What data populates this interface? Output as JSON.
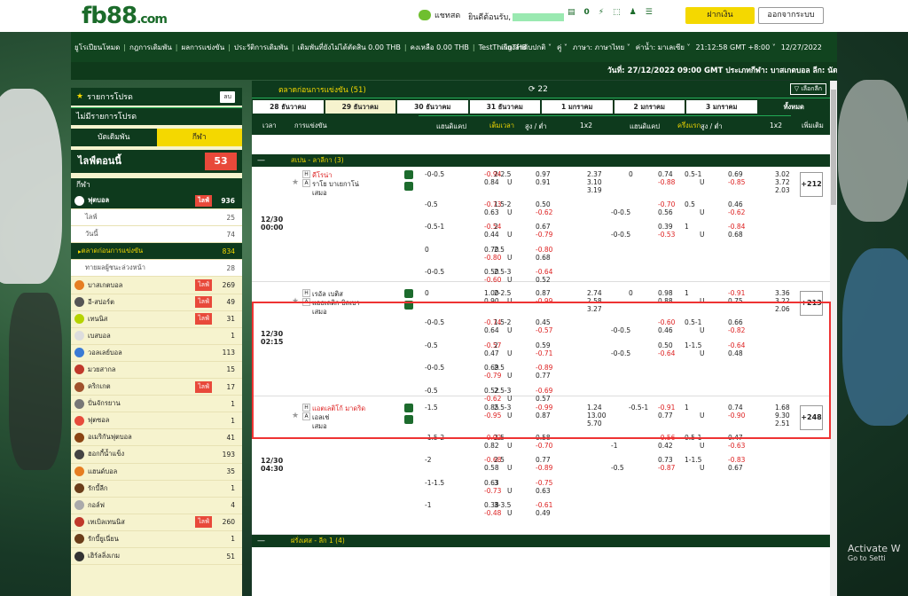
{
  "header": {
    "logo": "fb88",
    "logo_suffix": ".com",
    "chat": "แชทสด",
    "welcome": "ยินดีต้อนรับ,",
    "balance": "0",
    "deposit": "ฝากเงิน",
    "logout": "ออกจากระบบ"
  },
  "nav": {
    "items": [
      "ยูโรเปียนโหมด",
      "กฎการเดิมพัน",
      "ผลการแข่งขัน",
      "ประวัติการเดิมพัน",
      "เดิมพันที่ยังไม่ได้ตัดสิน 0.00 THB",
      "คงเหลือ 0.00 THB",
      "TestThingTHB"
    ],
    "right": [
      "เรียงลำดับปกติ ˅",
      "คู่ ˅",
      "ภาษา: ภาษาไทย ˅",
      "ค่าน้ำ: มาเลเซีย ˅",
      "21:12:58 GMT +8:00 ˅",
      "12/27/2022"
    ]
  },
  "ticker": "วันที่: 27/12/2022 09:00 GMT ประเภทกีฬา: บาสเกตบอล ลีก: นัดกระชับ",
  "left": {
    "title": "รายการโปรด",
    "read_only": "ลบ",
    "fav": "ไม่มีรายการโปรด",
    "tab_a": "บัตเดิมพัน",
    "tab_b": "กีฬา",
    "live_label": "ไลฟ์ตอนนี้",
    "live_count": "53",
    "sports_header": "กีฬา",
    "rows": [
      {
        "label": "ฟุตบอล",
        "live": "ไลฟ์",
        "count": "936",
        "kind": "sel",
        "icon": "soccer-ball-icon",
        "color": "#fff"
      },
      {
        "label": "ไลฟ์",
        "live": "",
        "count": "25",
        "kind": "sub",
        "icon": "",
        "color": ""
      },
      {
        "label": "วันนี้",
        "live": "",
        "count": "74",
        "kind": "sub",
        "icon": "",
        "color": ""
      },
      {
        "label": "ตลาดก่อนการแข่งขัน",
        "live": "",
        "count": "834",
        "kind": "act",
        "icon": "",
        "color": ""
      },
      {
        "label": "ทายผลผู้ชนะล่วงหน้า",
        "live": "",
        "count": "28",
        "kind": "sub",
        "icon": "",
        "color": ""
      },
      {
        "label": "บาสเกตบอล",
        "live": "ไลฟ์",
        "count": "269",
        "kind": "n",
        "icon": "basketball-icon",
        "color": "#e67e22"
      },
      {
        "label": "อี-สปอร์ต",
        "live": "ไลฟ์",
        "count": "49",
        "kind": "n",
        "icon": "gamepad-icon",
        "color": "#555"
      },
      {
        "label": "เทนนิส",
        "live": "ไลฟ์",
        "count": "31",
        "kind": "n",
        "icon": "tennis-ball-icon",
        "color": "#b5d300"
      },
      {
        "label": "เบสบอล",
        "live": "",
        "count": "1",
        "kind": "n",
        "icon": "baseball-icon",
        "color": "#ddd"
      },
      {
        "label": "วอลเลย์บอล",
        "live": "",
        "count": "113",
        "kind": "n",
        "icon": "volleyball-icon",
        "color": "#3a7bd5"
      },
      {
        "label": "มวยสากล",
        "live": "",
        "count": "15",
        "kind": "n",
        "icon": "boxing-glove-icon",
        "color": "#c0392b"
      },
      {
        "label": "คริกเกต",
        "live": "ไลฟ์",
        "count": "17",
        "kind": "n",
        "icon": "cricket-icon",
        "color": "#a0522d"
      },
      {
        "label": "ปั่นจักรยาน",
        "live": "",
        "count": "1",
        "kind": "n",
        "icon": "cycling-icon",
        "color": "#777"
      },
      {
        "label": "ฟุตซอล",
        "live": "",
        "count": "1",
        "kind": "n",
        "icon": "futsal-icon",
        "color": "#e74c3c"
      },
      {
        "label": "อเมริกันฟุตบอล",
        "live": "",
        "count": "41",
        "kind": "n",
        "icon": "american-football-icon",
        "color": "#8b4513"
      },
      {
        "label": "ฮอกกี้น้ำแข็ง",
        "live": "",
        "count": "193",
        "kind": "n",
        "icon": "hockey-icon",
        "color": "#444"
      },
      {
        "label": "แฮนด์บอล",
        "live": "",
        "count": "35",
        "kind": "n",
        "icon": "handball-icon",
        "color": "#e67e22"
      },
      {
        "label": "รักบี้ลีก",
        "live": "",
        "count": "1",
        "kind": "n",
        "icon": "rugby-icon",
        "color": "#6b3e1a"
      },
      {
        "label": "กอล์ฟ",
        "live": "",
        "count": "4",
        "kind": "n",
        "icon": "golf-icon",
        "color": "#aaa"
      },
      {
        "label": "เทเบิลเทนนิส",
        "live": "ไลฟ์",
        "count": "260",
        "kind": "n",
        "icon": "table-tennis-icon",
        "color": "#c0392b"
      },
      {
        "label": "รักบี้ยูเนี่ยน",
        "live": "",
        "count": "1",
        "kind": "n",
        "icon": "rugby-union-icon",
        "color": "#6b3e1a"
      },
      {
        "label": "เฮิร์ลลิ่งเกม",
        "live": "",
        "count": "51",
        "kind": "n",
        "icon": "darts-icon",
        "color": "#333"
      }
    ]
  },
  "main": {
    "title": "ตลาดก่อนการแข่งขัน (51)",
    "refresh": "22",
    "pick": "เลือกลีก",
    "dates": [
      "28 ธันวาคม",
      "29 ธันวาคม",
      "30 ธันวาคม",
      "31 ธันวาคม",
      "1 มกราคม",
      "2 มกราคม",
      "3 มกราคม",
      "ทั้งหมด"
    ],
    "cols": {
      "time": "เวลา",
      "event": "การแข่งขัน",
      "full": "เต็มเวลา",
      "half": "ครึ่งแรก",
      "hdp": "แฮนดิแคป",
      "ou": "สูง / ต่ำ",
      "x12": "1x2",
      "more": "เพิ่มเติม"
    },
    "league1": "สเปน - ลาลีกา (3)",
    "league2": "ฝรั่งเศส - ลีก 1 (4)",
    "matches": [
      {
        "date": "12/30",
        "time": "00:00",
        "home": "คีโรน่า",
        "away": "ราโย บาเยกาโน่",
        "draw": "เสมอ",
        "more": "+212",
        "x12": [
          "2.37",
          "3.10",
          "3.19"
        ],
        "hx12": [
          "3.02",
          "3.72",
          "2.03"
        ],
        "lines": [
          [
            "-0-0.5",
            "-0.94",
            "0.84",
            "2-2.5",
            "U",
            "0.97",
            "0.91",
            "0",
            "0.74",
            "-0.88",
            "0.5-1",
            "U",
            "0.69",
            "-0.85"
          ],
          [
            "-0.5",
            "-0.73",
            "0.63",
            "1.5-2",
            "U",
            "0.50",
            "-0.62",
            "-0-0.5",
            "-0.70",
            "0.56",
            "0.5",
            "U",
            "0.46",
            "-0.62"
          ],
          [
            "-0.5-1",
            "-0.54",
            "0.44",
            "2",
            "U",
            "0.67",
            "-0.79",
            "-0-0.5",
            "0.39",
            "-0.53",
            "1",
            "U",
            "-0.84",
            "0.68"
          ],
          [
            "0",
            "0.70",
            "-0.80",
            "2.5",
            "U",
            "-0.80",
            "0.68",
            "",
            "",
            "",
            "",
            "",
            "",
            ""
          ],
          [
            "-0-0.5",
            "0.50",
            "-0.60",
            "2.5-3",
            "U",
            "-0.64",
            "0.52",
            "",
            "",
            "",
            "",
            "",
            "",
            ""
          ]
        ]
      },
      {
        "date": "12/30",
        "time": "02:15",
        "home": "เรอัล เบติส",
        "away": "แอธเลติก บิลเบา",
        "draw": "เสมอ",
        "more": "+213",
        "x12": [
          "2.74",
          "2.58",
          "3.27"
        ],
        "hx12": [
          "3.36",
          "3.22",
          "2.06"
        ],
        "lines": [
          [
            "0",
            "1.00",
            "0.90",
            "2-2.5",
            "U",
            "0.87",
            "-0.99",
            "0",
            "0.98",
            "0.88",
            "1",
            "U",
            "-0.91",
            "0.75"
          ],
          [
            "-0-0.5",
            "-0.74",
            "0.64",
            "1.5-2",
            "U",
            "0.45",
            "-0.57",
            "-0-0.5",
            "-0.60",
            "0.46",
            "0.5-1",
            "U",
            "0.66",
            "-0.82"
          ],
          [
            "-0.5",
            "-0.57",
            "0.47",
            "2",
            "U",
            "0.59",
            "-0.71",
            "-0-0.5",
            "0.50",
            "-0.64",
            "1-1.5",
            "U",
            "-0.64",
            "0.48"
          ],
          [
            "-0-0.5",
            "0.69",
            "-0.79",
            "2.5",
            "U",
            "-0.89",
            "0.77",
            "",
            "",
            "",
            "",
            "",
            "",
            ""
          ],
          [
            "-0.5",
            "0.52",
            "-0.62",
            "2.5-3",
            "U",
            "-0.69",
            "0.57",
            "",
            "",
            "",
            "",
            "",
            "",
            ""
          ]
        ]
      },
      {
        "date": "12/30",
        "time": "04:30",
        "home": "แอตเลติโก้ มาดริด",
        "away": "เอลเช่",
        "draw": "เสมอ",
        "more": "+248",
        "x12": [
          "1.24",
          "13.00",
          "5.70"
        ],
        "hx12": [
          "1.68",
          "9.30",
          "2.51"
        ],
        "lines": [
          [
            "-1.5",
            "0.85",
            "-0.95",
            "2.5-3",
            "U",
            "-0.99",
            "0.87",
            "-0.5-1",
            "-0.91",
            "0.77",
            "1",
            "U",
            "0.74",
            "-0.90"
          ],
          [
            "-1.5-2",
            "-0.92",
            "0.82",
            "2.5",
            "U",
            "0.58",
            "-0.70",
            "-1",
            "-0.56",
            "0.42",
            "0.5-1",
            "U",
            "0.47",
            "-0.63"
          ],
          [
            "-2",
            "-0.68",
            "0.58",
            "2.5",
            "U",
            "0.77",
            "-0.89",
            "-0.5",
            "0.73",
            "-0.87",
            "1-1.5",
            "U",
            "-0.83",
            "0.67"
          ],
          [
            "-1-1.5",
            "0.63",
            "-0.73",
            "3",
            "U",
            "-0.75",
            "0.63",
            "",
            "",
            "",
            "",
            "",
            "",
            ""
          ],
          [
            "-1",
            "0.38",
            "-0.48",
            "3-3.5",
            "U",
            "-0.61",
            "0.49",
            "",
            "",
            "",
            "",
            "",
            "",
            ""
          ]
        ]
      }
    ]
  },
  "os": {
    "line1": "Activate W",
    "line2": "Go to Setti"
  }
}
